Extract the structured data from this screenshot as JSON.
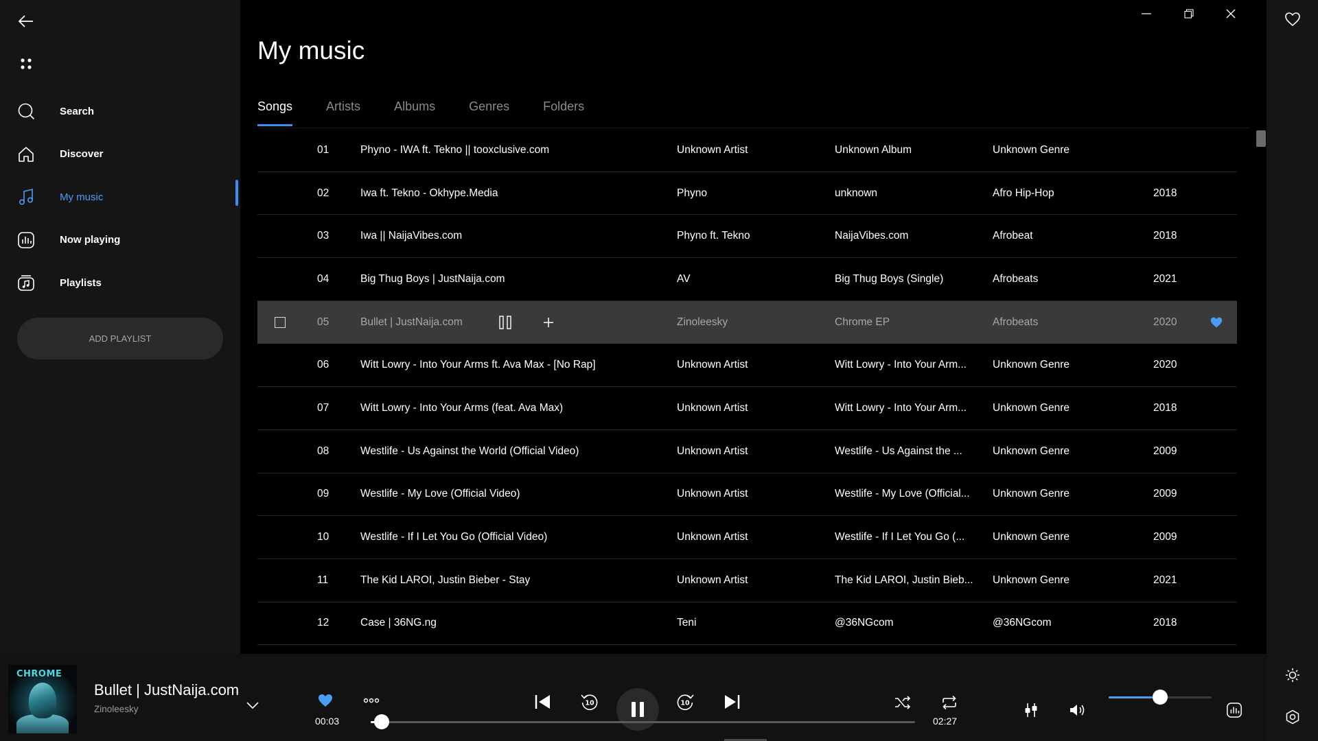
{
  "sidebar": {
    "nav": [
      {
        "label": "Search",
        "icon": "search-icon"
      },
      {
        "label": "Discover",
        "icon": "home-icon"
      },
      {
        "label": "My music",
        "icon": "music-note-icon",
        "active": true
      },
      {
        "label": "Now playing",
        "icon": "now-playing-icon"
      },
      {
        "label": "Playlists",
        "icon": "playlists-icon"
      }
    ],
    "add_playlist_label": "ADD PLAYLIST"
  },
  "main": {
    "title": "My music",
    "tabs": [
      "Songs",
      "Artists",
      "Albums",
      "Genres",
      "Folders"
    ],
    "active_tab": "Songs",
    "songs": [
      {
        "num": "01",
        "title": "Phyno - IWA ft. Tekno || tooxclusive.com",
        "artist": "Unknown Artist",
        "album": "Unknown Album",
        "genre": "Unknown Genre",
        "year": ""
      },
      {
        "num": "02",
        "title": "Iwa ft. Tekno - Okhype.Media",
        "artist": "Phyno",
        "album": "unknown",
        "genre": "Afro Hip-Hop",
        "year": "2018"
      },
      {
        "num": "03",
        "title": "Iwa || NaijaVibes.com",
        "artist": "Phyno ft. Tekno",
        "album": "NaijaVibes.com",
        "genre": "Afrobeat",
        "year": "2018"
      },
      {
        "num": "04",
        "title": "Big Thug Boys | JustNaija.com",
        "artist": "AV",
        "album": "Big Thug Boys (Single)",
        "genre": "Afrobeats",
        "year": "2021"
      },
      {
        "num": "05",
        "title": "Bullet | JustNaija.com",
        "artist": "Zinoleesky",
        "album": "Chrome EP",
        "genre": "Afrobeats",
        "year": "2020",
        "selected": true,
        "liked": true
      },
      {
        "num": "06",
        "title": "Witt Lowry - Into Your Arms ft. Ava Max - [No Rap]",
        "artist": "Unknown Artist",
        "album": "Witt Lowry - Into Your Arm...",
        "genre": "Unknown Genre",
        "year": "2020"
      },
      {
        "num": "07",
        "title": "Witt Lowry - Into Your Arms (feat. Ava Max)",
        "artist": "Unknown Artist",
        "album": "Witt Lowry - Into Your Arm...",
        "genre": "Unknown Genre",
        "year": "2018"
      },
      {
        "num": "08",
        "title": "Westlife - Us Against the World (Official Video)",
        "artist": "Unknown Artist",
        "album": "Westlife - Us Against the ...",
        "genre": "Unknown Genre",
        "year": "2009"
      },
      {
        "num": "09",
        "title": "Westlife - My Love (Official Video)",
        "artist": "Unknown Artist",
        "album": "Westlife - My Love (Official...",
        "genre": "Unknown Genre",
        "year": "2009"
      },
      {
        "num": "10",
        "title": "Westlife - If I Let You Go (Official Video)",
        "artist": "Unknown Artist",
        "album": "Westlife - If I Let You Go (...",
        "genre": "Unknown Genre",
        "year": "2009"
      },
      {
        "num": "11",
        "title": "The Kid LAROI, Justin Bieber - Stay",
        "artist": "Unknown Artist",
        "album": "The Kid LAROI, Justin Bieb...",
        "genre": "Unknown Genre",
        "year": "2021"
      },
      {
        "num": "12",
        "title": "Case | 36NG.ng",
        "artist": "Teni",
        "album": "@36NGcom",
        "genre": "@36NGcom",
        "year": "2018"
      }
    ]
  },
  "player": {
    "album_art_text": "CHROME",
    "title": "Bullet | JustNaija.com",
    "artist": "Zinoleesky",
    "elapsed": "00:03",
    "duration": "02:27",
    "progress": 0.02,
    "volume": 0.5,
    "liked": true
  },
  "colors": {
    "accent": "#4b9cf5",
    "sidebar_bg": "#151515",
    "main_bg": "#000000",
    "selected_row": "#3a3a3a",
    "player_bg": "#121212"
  }
}
